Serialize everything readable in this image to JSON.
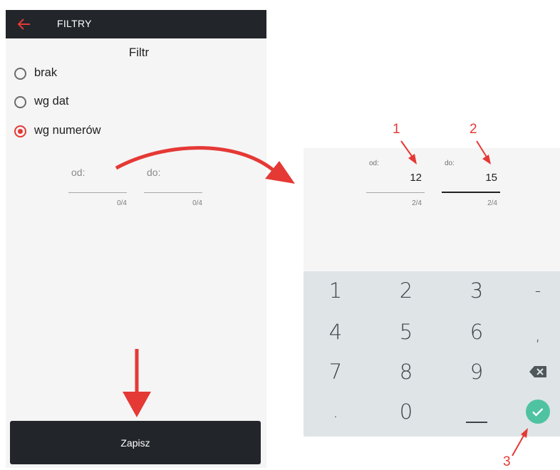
{
  "left": {
    "appbar_title": "FILTRY",
    "heading": "Filtr",
    "radio_options": [
      {
        "label": "brak",
        "selected": false
      },
      {
        "label": "wg dat",
        "selected": false
      },
      {
        "label": "wg numerów",
        "selected": true
      }
    ],
    "from_field": {
      "label": "od:",
      "counter": "0/4"
    },
    "to_field": {
      "label": "do:",
      "counter": "0/4"
    },
    "save_label": "Zapisz"
  },
  "right": {
    "from_field": {
      "label": "od:",
      "value": "12",
      "counter": "2/4"
    },
    "to_field": {
      "label": "do:",
      "value": "15",
      "counter": "2/4"
    },
    "keyboard": {
      "rows": [
        [
          "1",
          "2",
          "3",
          "-"
        ],
        [
          "4",
          "5",
          "6",
          ","
        ],
        [
          "7",
          "8",
          "9",
          "⌫"
        ],
        [
          ".",
          "0",
          "␣",
          "✓"
        ]
      ]
    }
  },
  "annotations": [
    "1",
    "2",
    "3"
  ],
  "colors": {
    "accent": "#e53935",
    "appbar": "#22252a",
    "confirm": "#4fc3a1",
    "keyboard": "#dfe4e7"
  }
}
